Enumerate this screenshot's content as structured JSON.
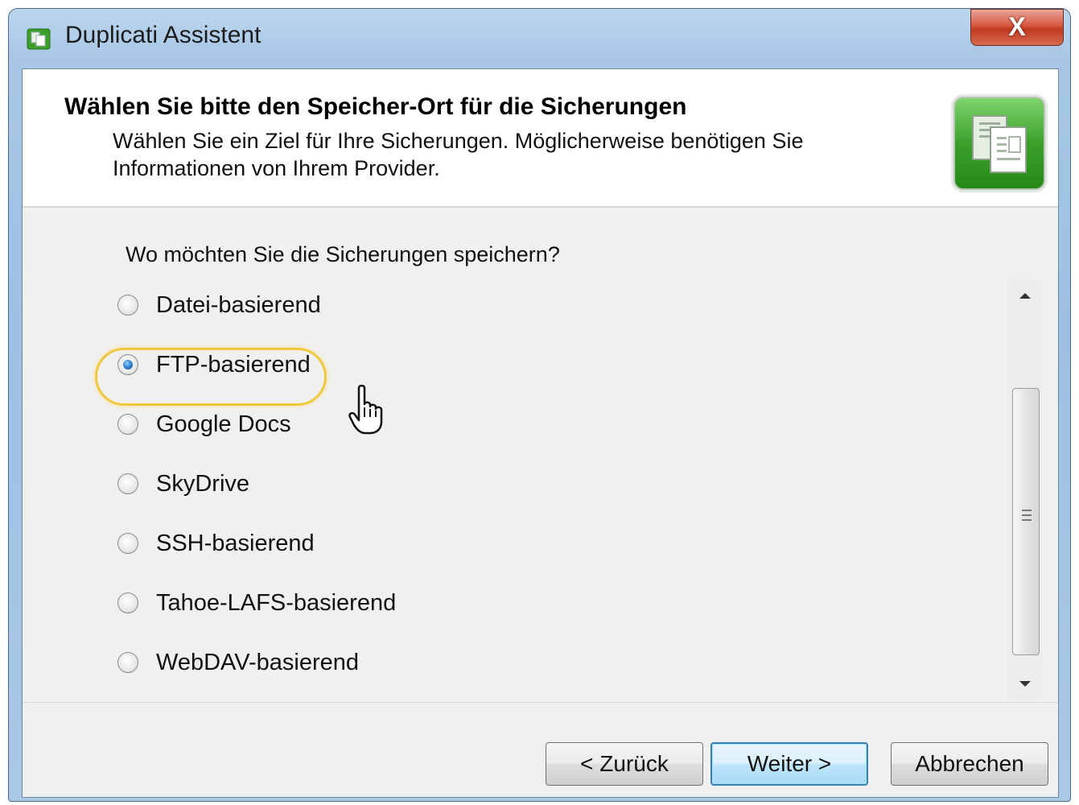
{
  "window": {
    "title": "Duplicati Assistent",
    "close_label": "X"
  },
  "header": {
    "title": "Wählen Sie bitte den Speicher-Ort für die Sicherungen",
    "description": "Wählen Sie ein Ziel für Ihre Sicherungen. Möglicherweise benötigen Sie Informationen von Ihrem Provider."
  },
  "question": "Wo möchten Sie die Sicherungen speichern?",
  "options": [
    {
      "label": "Datei-basierend",
      "checked": false
    },
    {
      "label": "FTP-basierend",
      "checked": true
    },
    {
      "label": "Google Docs",
      "checked": false
    },
    {
      "label": "SkyDrive",
      "checked": false
    },
    {
      "label": "SSH-basierend",
      "checked": false
    },
    {
      "label": "Tahoe-LAFS-basierend",
      "checked": false
    },
    {
      "label": "WebDAV-basierend",
      "checked": false
    }
  ],
  "buttons": {
    "back": "< Zurück",
    "next": "Weiter >",
    "cancel": "Abbrechen"
  },
  "colors": {
    "close_button": "#c23a22",
    "highlight_ring": "#f0c840",
    "wizard_icon": "#3aa02a",
    "default_button_border": "#3c7fb1"
  },
  "icons": {
    "app": "duplicati-app-icon",
    "wizard": "documents-icon",
    "cursor": "hand-pointer-icon"
  }
}
